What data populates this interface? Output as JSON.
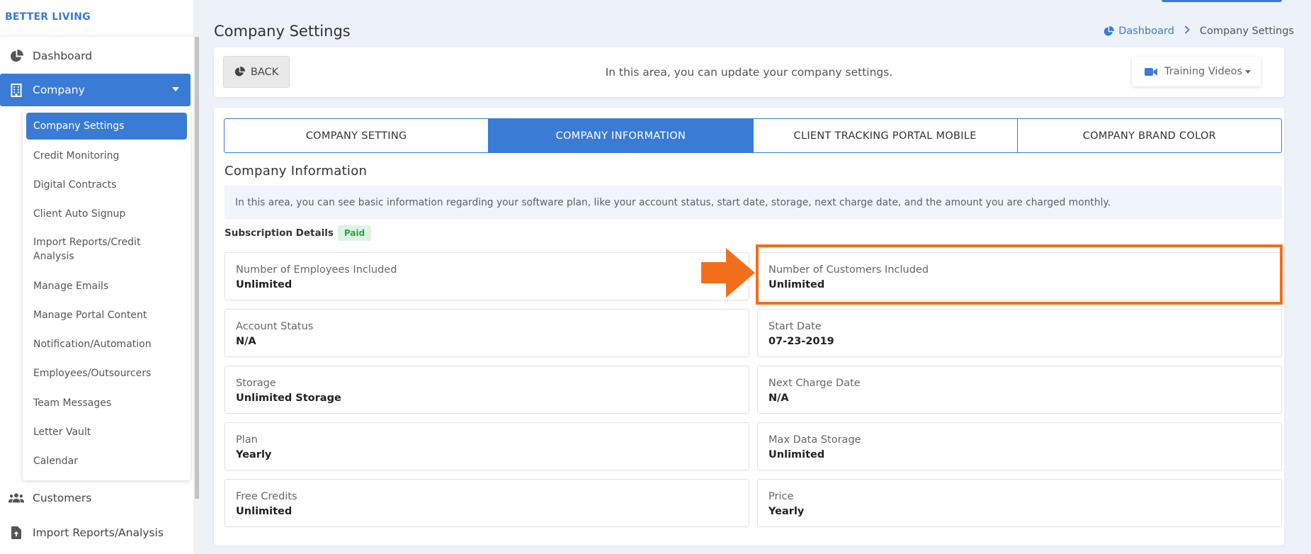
{
  "brand": "BETTER LIVING",
  "sidebar": {
    "items": [
      {
        "label": "Dashboard",
        "icon": "pie-chart-icon"
      },
      {
        "label": "Company",
        "icon": "building-icon"
      },
      {
        "label": "Customers",
        "icon": "users-icon"
      },
      {
        "label": "Import Reports/Analysis",
        "icon": "file-upload-icon"
      }
    ],
    "submenu": [
      "Company Settings",
      "Credit Monitoring",
      "Digital Contracts",
      "Client Auto Signup",
      "Import Reports/Credit Analysis",
      "Manage Emails",
      "Manage Portal Content",
      "Notification/Automation",
      "Employees/Outsourcers",
      "Team Messages",
      "Letter Vault",
      "Calendar"
    ]
  },
  "header": {
    "title": "Company Settings",
    "breadcrumb": {
      "home": "Dashboard",
      "current": "Company Settings"
    }
  },
  "toolbar": {
    "back_label": "BACK",
    "message": "In this area, you can update your company settings.",
    "training_label": "Training Videos"
  },
  "tabs": [
    {
      "label": "COMPANY SETTING",
      "active": false
    },
    {
      "label": "COMPANY INFORMATION",
      "active": true
    },
    {
      "label": "CLIENT TRACKING PORTAL MOBILE",
      "active": false
    },
    {
      "label": "COMPANY BRAND COLOR",
      "active": false
    }
  ],
  "company_info": {
    "title": "Company Information",
    "description": "In this area, you can see basic information regarding your software plan, like your account status, start date, storage, next charge date, and the amount you are charged monthly.",
    "subscription_label": "Subscription Details",
    "subscription_status": "Paid",
    "fields": [
      {
        "label": "Number of Employees Included",
        "value": "Unlimited"
      },
      {
        "label": "Number of Customers Included",
        "value": "Unlimited"
      },
      {
        "label": "Account Status",
        "value": "N/A"
      },
      {
        "label": "Start Date",
        "value": "07-23-2019"
      },
      {
        "label": "Storage",
        "value": "Unlimited Storage"
      },
      {
        "label": "Next Charge Date",
        "value": "N/A"
      },
      {
        "label": "Plan",
        "value": "Yearly"
      },
      {
        "label": "Max Data Storage",
        "value": "Unlimited"
      },
      {
        "label": "Free Credits",
        "value": "Unlimited"
      },
      {
        "label": "Price",
        "value": "Yearly"
      }
    ]
  },
  "colors": {
    "primary": "#3a7bd5",
    "highlight": "#f36f1c",
    "paid_bg": "#dff3e4",
    "paid_text": "#29a54a"
  }
}
